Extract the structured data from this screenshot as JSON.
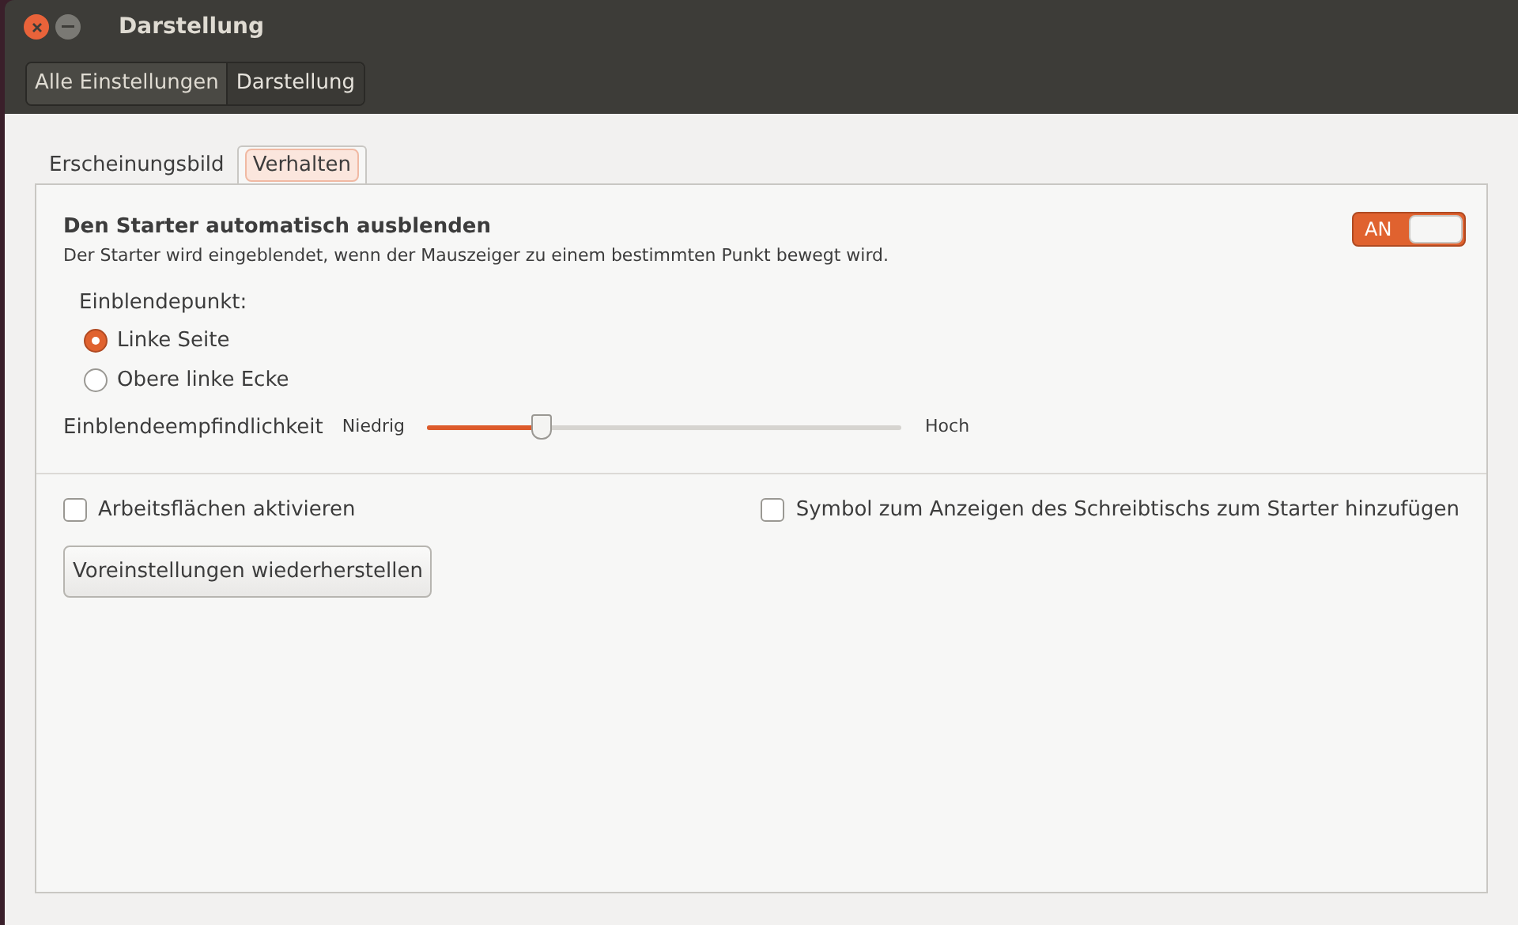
{
  "window": {
    "title": "Darstellung"
  },
  "breadcrumbs": [
    {
      "label": "Alle Einstellungen",
      "selected": false
    },
    {
      "label": "Darstellung",
      "selected": true
    }
  ],
  "tabs": [
    {
      "label": "Erscheinungsbild",
      "selected": false
    },
    {
      "label": "Verhalten",
      "selected": true
    }
  ],
  "autohide": {
    "title": "Den Starter automatisch ausblenden",
    "description": "Der Starter wird eingeblendet, wenn der Mauszeiger zu einem bestimmten Punkt bewegt wird.",
    "switch_label": "AN",
    "on": true
  },
  "reveal_location": {
    "label": "Einblendepunkt:",
    "options": [
      {
        "label": "Linke Seite",
        "selected": true
      },
      {
        "label": "Obere linke Ecke",
        "selected": false
      }
    ]
  },
  "sensitivity": {
    "label": "Einblendeempfindlichkeit",
    "min_label": "Niedrig",
    "max_label": "Hoch",
    "level": 0.24
  },
  "checkboxes": [
    {
      "label": "Arbeitsflächen aktivieren",
      "checked": false
    },
    {
      "label": "Symbol zum Anzeigen des Schreibtischs zum Starter hinzufügen",
      "checked": false
    }
  ],
  "reset_button": "Voreinstellungen wiederherstellen"
}
